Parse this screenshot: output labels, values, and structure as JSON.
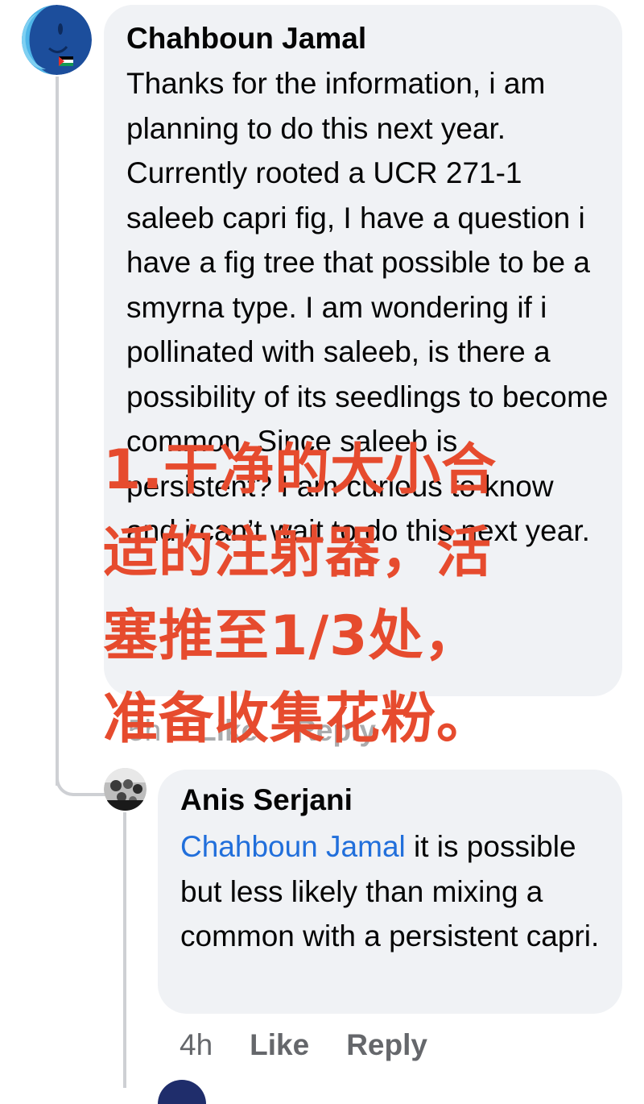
{
  "comments": [
    {
      "author": "Chahboun Jamal",
      "text": "Thanks for the information, i am planning to do this next year. Currently rooted a UCR 271-1 saleeb capri fig, I have a question i have a fig tree that possible to be a smyrna type. I am wondering if i pollinated with saleeb, is there a possibility of its seedlings to become common. Since saleeb is persistent?  I am curious to know and i can’t wait to do this next year.",
      "time": "5h",
      "like_label": "Like",
      "reply_label": "Reply"
    }
  ],
  "reply": {
    "author": "Anis Serjani",
    "mention": "Chahboun Jamal",
    "text": " it is possible but less likely than mixing a common with a persistent capri.",
    "time": "4h",
    "like_label": "Like",
    "reply_label": "Reply"
  },
  "overlay_caption": "1.干净的大小合\n适的注射器，活\n塞推至1/3处，\n准备收集花粉。",
  "colors": {
    "bubble": "#f0f2f5",
    "mention": "#216fdb",
    "overlay_text": "#e64b2e",
    "meta_text": "#65676b"
  }
}
